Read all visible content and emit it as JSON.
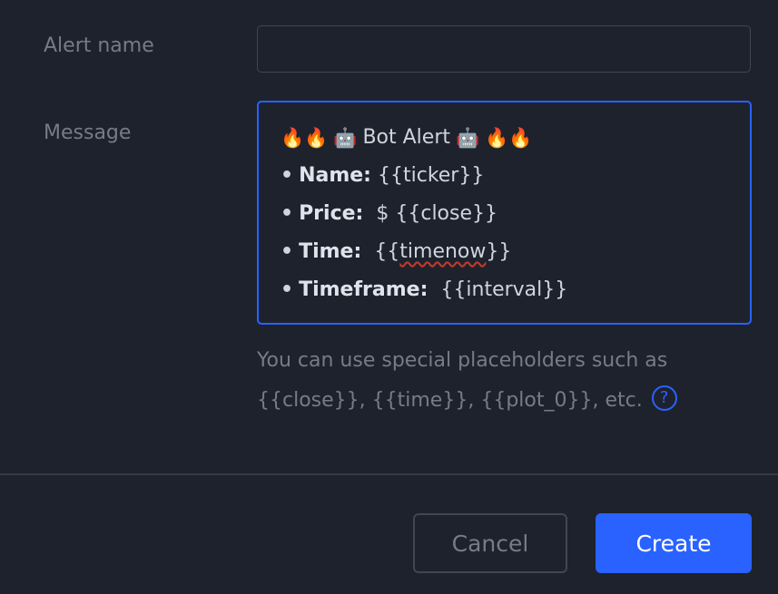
{
  "form": {
    "alert_name_label": "Alert name",
    "alert_name_value": "",
    "message_label": "Message"
  },
  "message": {
    "title_prefix_emoji": "🔥🔥",
    "robot_emoji": "🤖",
    "title_text": "Bot Alert",
    "title_suffix_emoji": "🔥🔥",
    "bullet": "•",
    "lines": [
      {
        "key": "Name",
        "sep": ":",
        "value": "{{ticker}}"
      },
      {
        "key": "Price",
        "sep": ":",
        "value": "$ {{close}}"
      },
      {
        "key": "Time",
        "sep": ":",
        "value_prefix": "{{",
        "value_mid": "timenow",
        "value_suffix": "}}"
      },
      {
        "key": "Timeframe",
        "sep": ":",
        "value": "{{interval}}"
      }
    ]
  },
  "hint": {
    "line1": "You can use special placeholders such as",
    "line2": "{{close}}, {{time}}, {{plot_0}}, etc.",
    "help_icon": "question-circle-icon",
    "help_glyph": "?"
  },
  "footer": {
    "cancel_label": "Cancel",
    "create_label": "Create"
  },
  "colors": {
    "background": "#1e222d",
    "accent": "#2962ff",
    "muted_text": "#787b86",
    "border": "#434651"
  }
}
